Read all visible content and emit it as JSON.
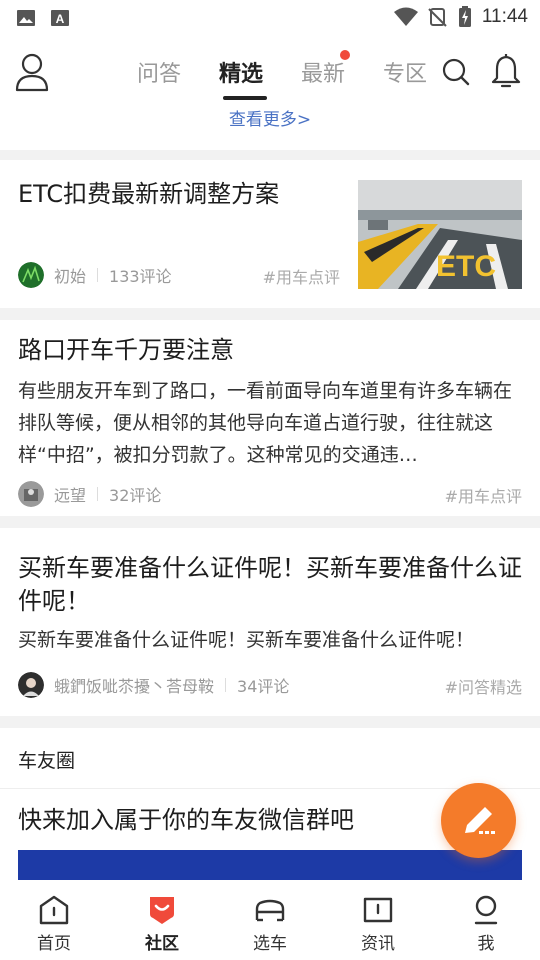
{
  "status_bar": {
    "time": "11:44",
    "icons": [
      "image-icon",
      "a-icon",
      "wifi-icon",
      "no-signal-icon",
      "battery-charging-icon"
    ]
  },
  "top_nav": {
    "tabs": [
      {
        "label": "问答",
        "active": false,
        "dot": false
      },
      {
        "label": "精选",
        "active": true,
        "dot": false
      },
      {
        "label": "最新",
        "active": false,
        "dot": true
      },
      {
        "label": "专区",
        "active": false,
        "dot": false
      }
    ],
    "icons": [
      "user-icon",
      "search-icon",
      "bell-icon"
    ]
  },
  "see_more": "查看更多>",
  "posts": [
    {
      "title": "ETC扣费最新新调整方案",
      "author": "初始",
      "comments": "133评论",
      "tag": "#用车点评",
      "thumbnail_text": "ETC"
    },
    {
      "title": "路口开车千万要注意",
      "summary": "有些朋友开车到了路口，一看前面导向车道里有许多车辆在排队等候，便从相邻的其他导向车道占道行驶，往往就这样“中招”，被扣分罚款了。这种常见的交通违…",
      "author": "远望",
      "comments": "32评论",
      "tag": "#用车点评"
    },
    {
      "title": "买新车要准备什么证件呢！买新车要准备什么证件呢！",
      "summary": "买新车要准备什么证件呢！买新车要准备什么证件呢！",
      "author": "蛾鍆饭呲苶擾丶荅母鞍",
      "comments": "34评论",
      "tag": "#问答精选"
    }
  ],
  "car_friends": {
    "section_label": "车友圈",
    "title": "快来加入属于你的车友微信群吧"
  },
  "fab_icon": "edit-icon",
  "bottom_nav": [
    {
      "label": "首页",
      "icon": "home-icon",
      "active": false
    },
    {
      "label": "社区",
      "icon": "community-icon",
      "active": true
    },
    {
      "label": "选车",
      "icon": "car-icon",
      "active": false
    },
    {
      "label": "资讯",
      "icon": "news-icon",
      "active": false
    },
    {
      "label": "我",
      "icon": "profile-icon",
      "active": false
    }
  ],
  "colors": {
    "accent_orange": "#f47b2a",
    "active_red": "#f04a3a",
    "link_blue": "#4a72c4"
  }
}
